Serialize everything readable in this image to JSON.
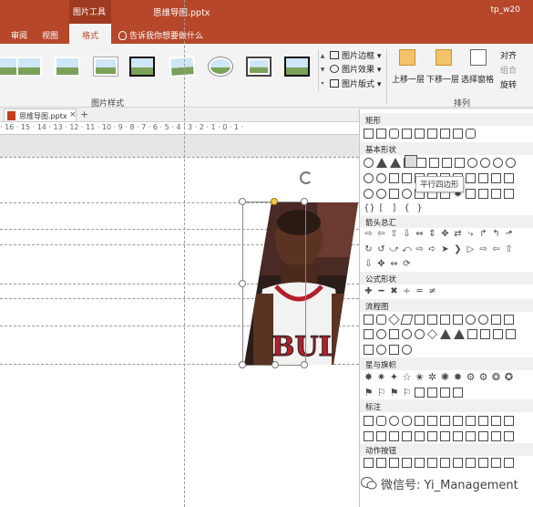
{
  "titlebar": {
    "contextual_tab_group": "图片工具",
    "document_title": "思维导图.pptx",
    "right_text": "tp_w20"
  },
  "tabs": {
    "review": "审阅",
    "view": "视图",
    "format": "格式",
    "tell_me": "告诉我你想要做什么"
  },
  "ribbon": {
    "picture_border": "图片边框",
    "picture_effects": "图片效果",
    "picture_layout": "图片版式",
    "bring_forward": "上移一层",
    "send_backward": "下移一层",
    "selection_pane": "选择窗格",
    "align": "对齐",
    "group": "组合",
    "rotate": "旋转",
    "group_picture_styles": "图片样式",
    "group_arrange": "排列"
  },
  "document_tab": {
    "filename": "思维导图.pptx",
    "close": "×",
    "add": "+"
  },
  "ruler": {
    "text": "· 16 · 15 · 14 · 13 · 12 · 11 · 10 · 9 · 8 · 7 · 6 · 5 · 4 · 3 · 2 · 1 · 0 · 1 ·"
  },
  "shapes_panel": {
    "sections": {
      "rectangle": "矩形",
      "basic_shapes": "基本形状",
      "block_arrows": "箭头总汇",
      "equation_shapes": "公式形状",
      "flowchart": "流程图",
      "stars_banners": "星与旗帜",
      "callouts": "标注",
      "action_buttons": "动作按钮"
    },
    "tooltip": "平行四边形"
  },
  "watermark": {
    "text": "微信号: Yi_Management"
  },
  "colors": {
    "accent": "#b7472a",
    "ribbon_bg": "#f3f3f3",
    "canvas_bg": "#e6e6e6"
  }
}
